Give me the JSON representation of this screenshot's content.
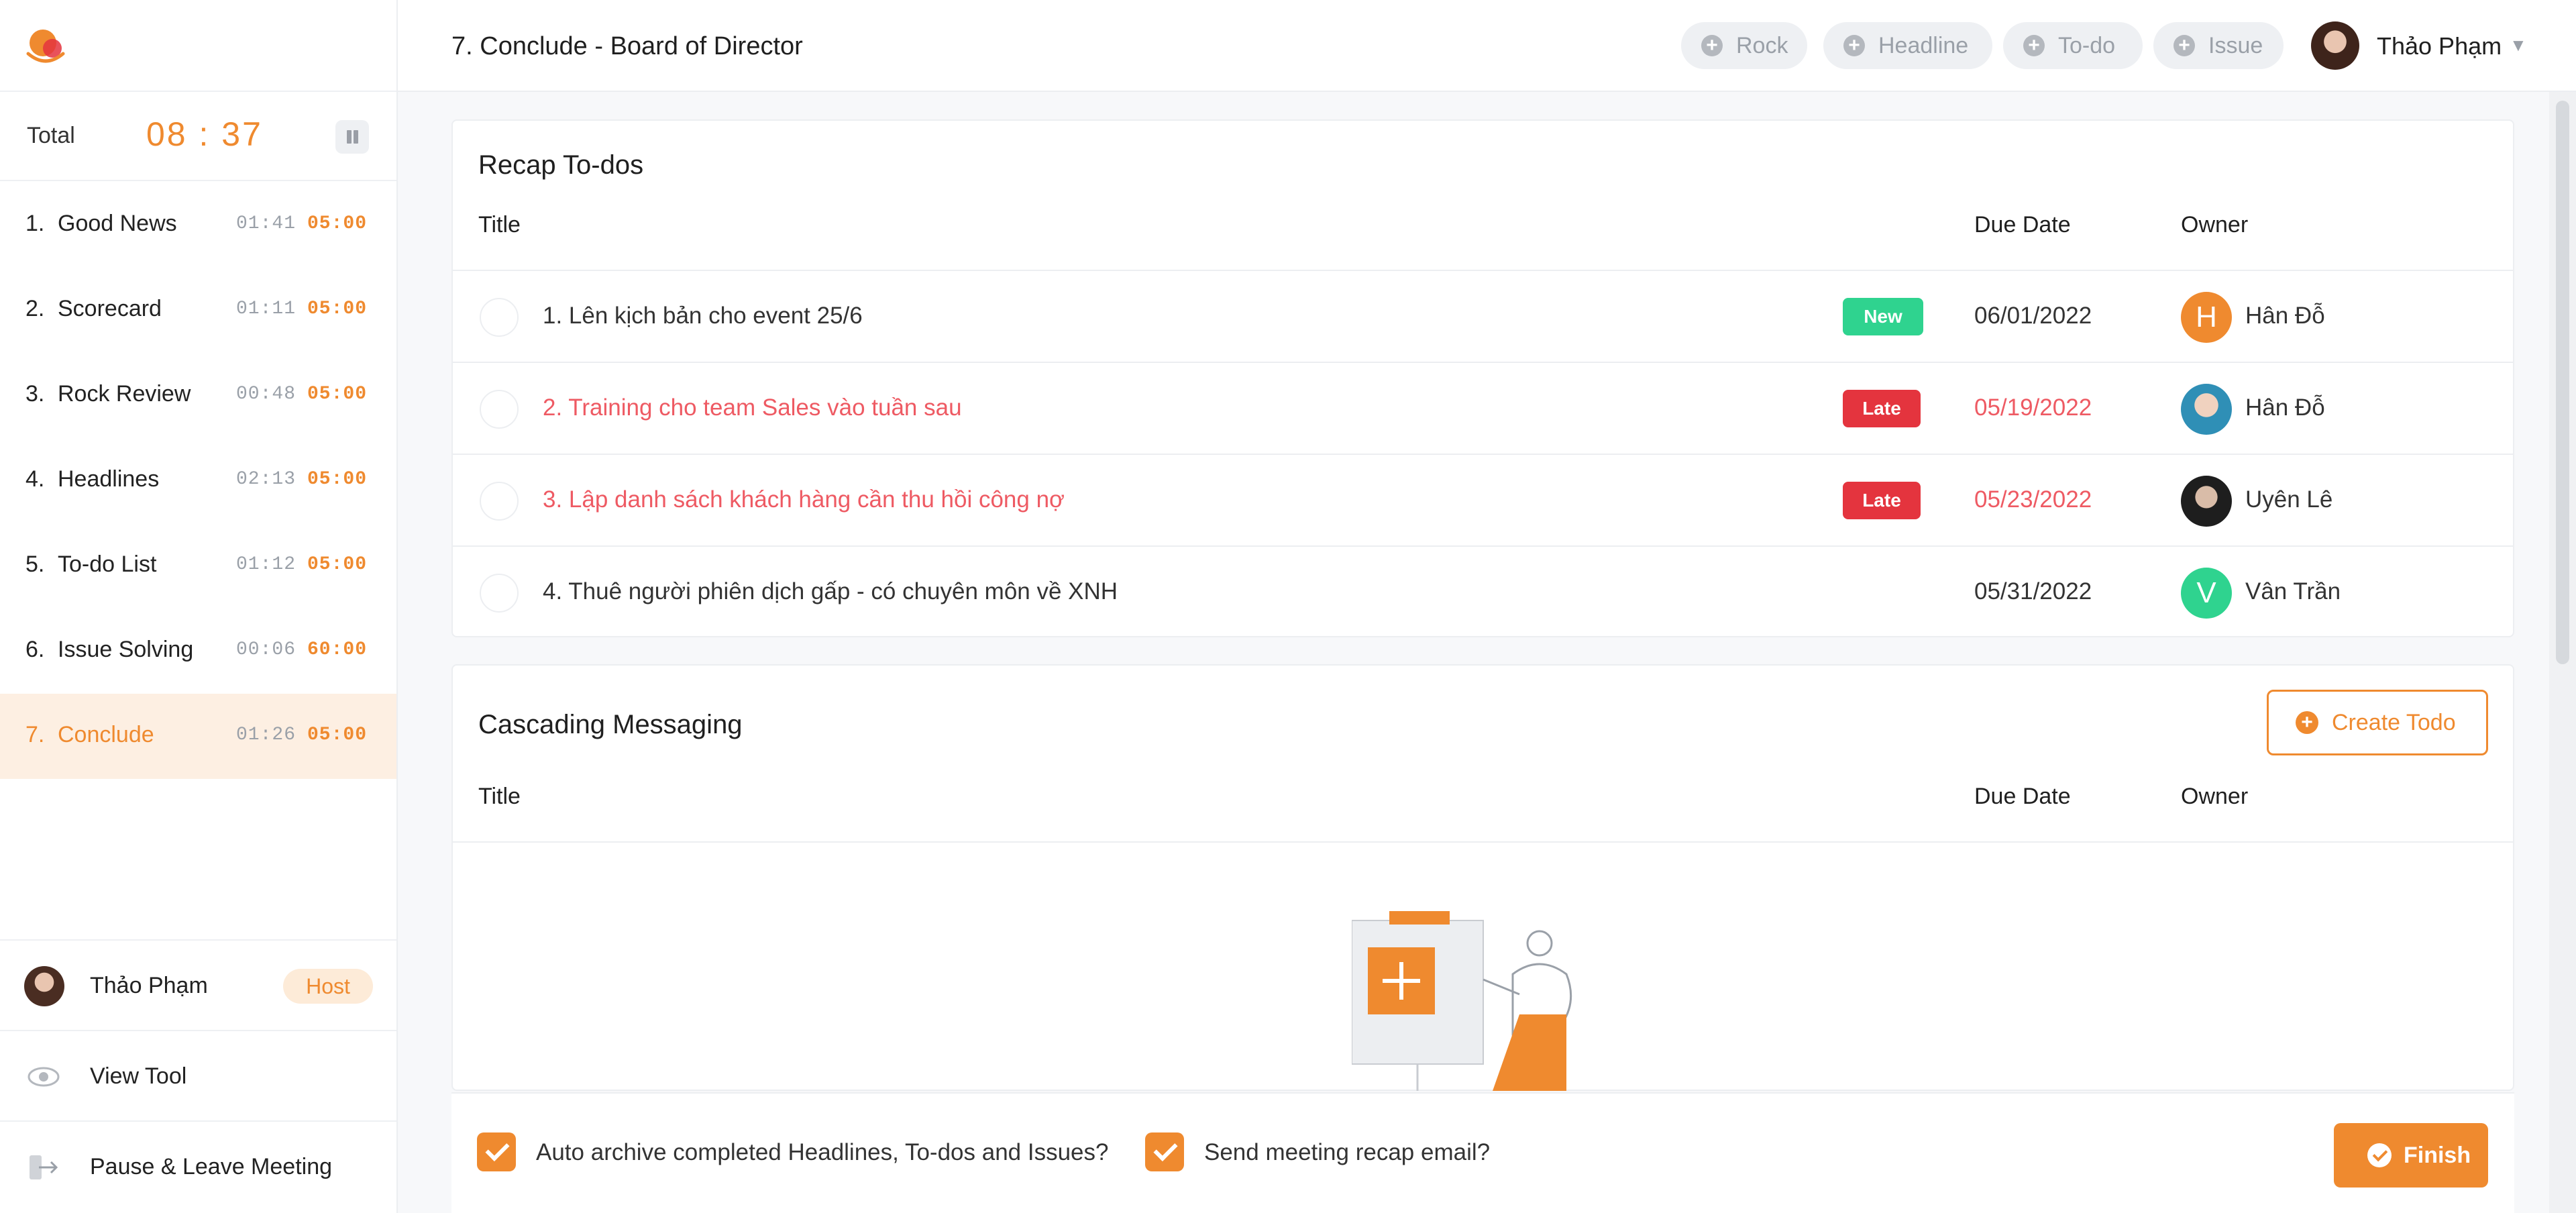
{
  "colors": {
    "accent": "#ef8a2f",
    "late": "#e4343e",
    "new": "#2fd38f"
  },
  "header": {
    "title": "7. Conclude - Board of Director",
    "add_pills": [
      {
        "label": "Rock",
        "icon": "plus-circle-icon"
      },
      {
        "label": "Headline",
        "icon": "plus-circle-icon"
      },
      {
        "label": "To-do",
        "icon": "plus-circle-icon"
      },
      {
        "label": "Issue",
        "icon": "plus-circle-icon"
      }
    ],
    "user": {
      "name": "Thảo Phạm"
    }
  },
  "sidebar": {
    "total_label": "Total",
    "total_time": "08 : 37",
    "agenda": [
      {
        "num": "1.",
        "label": "Good News",
        "elapsed": "01:41",
        "limit": "05:00"
      },
      {
        "num": "2.",
        "label": "Scorecard",
        "elapsed": "01:11",
        "limit": "05:00"
      },
      {
        "num": "3.",
        "label": "Rock Review",
        "elapsed": "00:48",
        "limit": "05:00"
      },
      {
        "num": "4.",
        "label": "Headlines",
        "elapsed": "02:13",
        "limit": "05:00"
      },
      {
        "num": "5.",
        "label": "To-do List",
        "elapsed": "01:12",
        "limit": "05:00"
      },
      {
        "num": "6.",
        "label": "Issue Solving",
        "elapsed": "00:06",
        "limit": "60:00"
      },
      {
        "num": "7.",
        "label": "Conclude",
        "elapsed": "01:26",
        "limit": "05:00"
      }
    ],
    "host": {
      "name": "Thảo Phạm",
      "badge": "Host"
    },
    "view_tool": "View Tool",
    "leave": "Pause & Leave Meeting"
  },
  "recap": {
    "title": "Recap To-dos",
    "columns": {
      "title": "Title",
      "due": "Due Date",
      "owner": "Owner"
    },
    "rows": [
      {
        "title": "1. Lên kịch bản cho event 25/6",
        "badge": "New",
        "due": "06/01/2022",
        "owner": "Hân Đỗ",
        "initial": "H",
        "late": false
      },
      {
        "title": "2. Training cho team Sales vào tuần sau",
        "badge": "Late",
        "due": "05/19/2022",
        "owner": "Hân Đỗ",
        "initial": "",
        "late": true
      },
      {
        "title": "3. Lập danh sách khách hàng cần thu hồi công nợ",
        "badge": "Late",
        "due": "05/23/2022",
        "owner": "Uyên Lê",
        "initial": "",
        "late": true
      },
      {
        "title": "4. Thuê người phiên dịch gấp - có chuyên môn về XNH",
        "badge": "",
        "due": "05/31/2022",
        "owner": "Vân Trần",
        "initial": "V",
        "late": false
      }
    ]
  },
  "cascade": {
    "title": "Cascading Messaging",
    "create_label": "Create Todo",
    "columns": {
      "title": "Title",
      "due": "Due Date",
      "owner": "Owner"
    }
  },
  "footer": {
    "auto_archive": "Auto archive completed Headlines, To-dos and Issues?",
    "send_recap": "Send meeting recap email?",
    "finish": "Finish"
  }
}
